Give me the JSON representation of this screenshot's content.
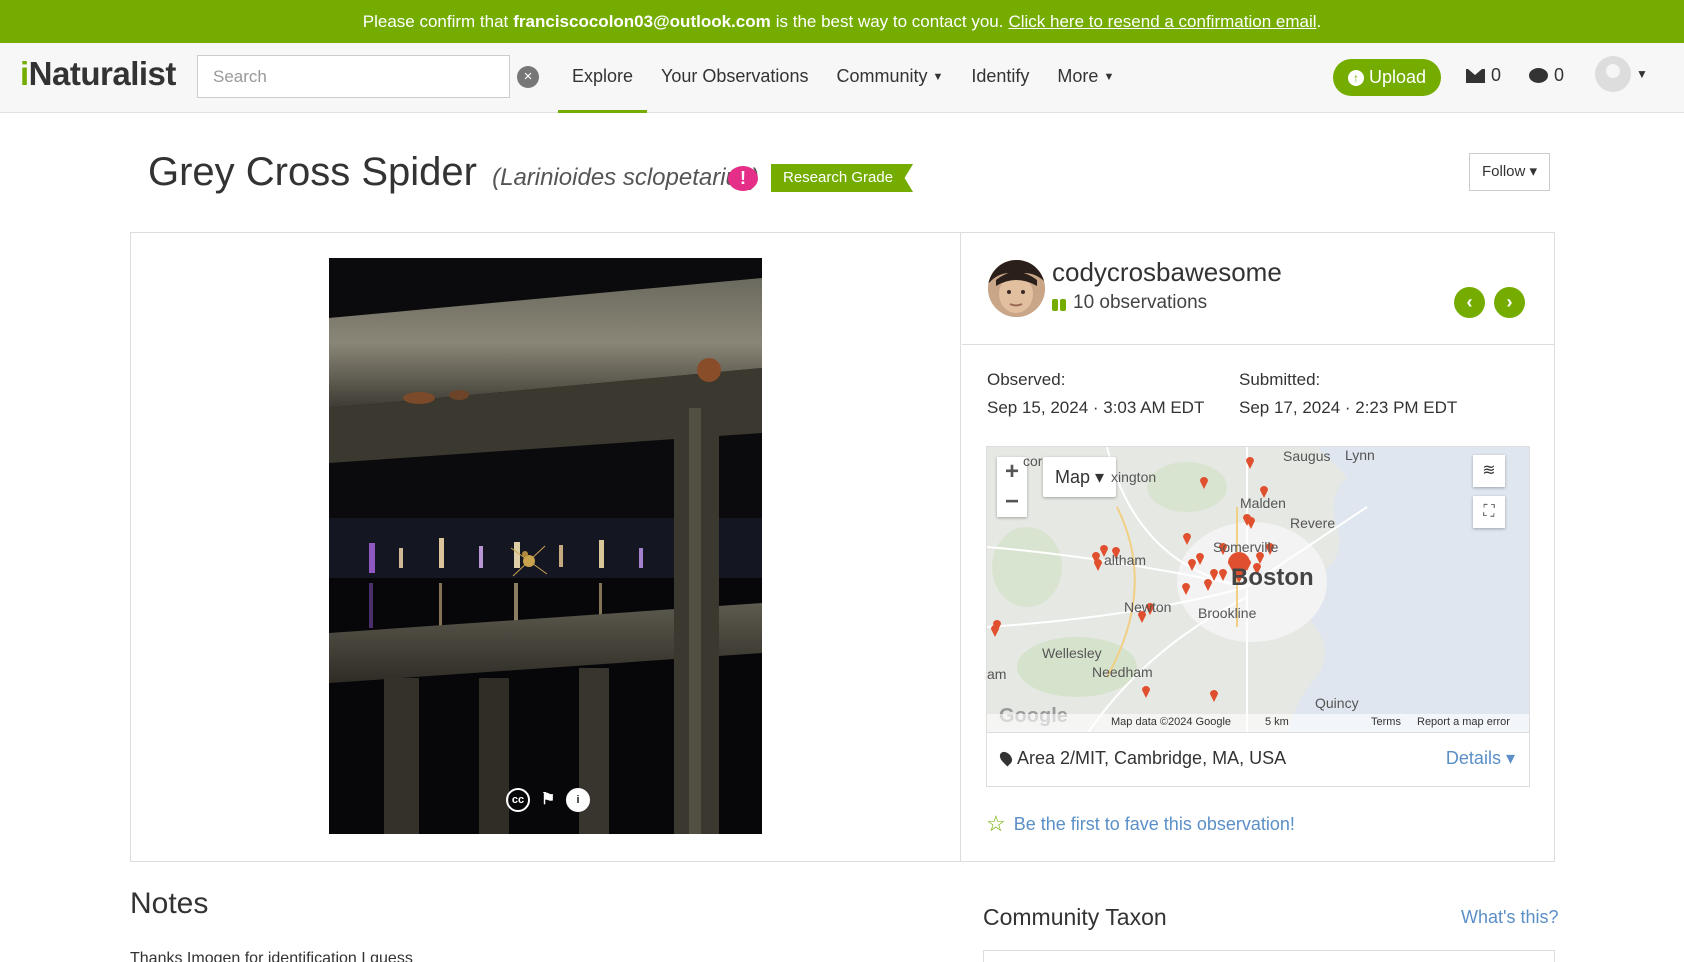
{
  "banner": {
    "prefix": "Please confirm that",
    "email": "franciscocolon03@outlook.com",
    "middle": "is the best way to contact you.",
    "link": "Click here to resend a confirmation email",
    "suffix": "."
  },
  "header": {
    "logo_mark": "i",
    "logo_rest": "Naturalist",
    "search_placeholder": "Search",
    "clear_icon": "×",
    "nav": [
      {
        "label": "Explore"
      },
      {
        "label": "Your Observations"
      },
      {
        "label": "Community"
      },
      {
        "label": "Identify"
      },
      {
        "label": "More"
      }
    ],
    "upload_label": "Upload",
    "messages_count": "0",
    "notifications_count": "0"
  },
  "observation": {
    "common_name": "Grey Cross Spider",
    "scientific_name": "(Larinioides sclopetarius)",
    "alert_icon": "!",
    "quality_grade": "Research Grade",
    "follow_label": "Follow"
  },
  "observer": {
    "username": "codycrosbawesome",
    "observations_label": "10 observations"
  },
  "dates": {
    "observed_label": "Observed:",
    "observed_value": "Sep 15, 2024 · 3:03 AM EDT",
    "submitted_label": "Submitted:",
    "submitted_value": "Sep 17, 2024 · 2:23 PM EDT"
  },
  "map": {
    "type_label": "Map",
    "labels": {
      "saugus": "Saugus",
      "lynn": "Lynn",
      "lexington": "xington",
      "malden": "Malden",
      "revere": "Revere",
      "somerville": "Somerville",
      "waltham": "altham",
      "boston": "Boston",
      "newton": "Newton",
      "brookline": "Brookline",
      "wellesley": "Wellesley",
      "needham": "Needham",
      "quincy": "Quincy",
      "cor": "cor",
      "am": "am"
    },
    "attribution": {
      "google": "Google",
      "data": "Map data ©2024 Google",
      "scale": "5 km",
      "terms": "Terms",
      "report": "Report a map error"
    }
  },
  "location": {
    "text": "Area 2/MIT, Cambridge, MA, USA",
    "details_label": "Details"
  },
  "fave_label": "Be the first to fave this observation!",
  "notes": {
    "heading": "Notes",
    "body": "Thanks Imogen for identification I guess"
  },
  "community_taxon": {
    "heading": "Community Taxon",
    "help_link": "What's this?"
  },
  "colors": {
    "brand": "#74ac00",
    "link": "#5a8fc7",
    "alert": "#e52e88",
    "map_pin": "#e0502e"
  }
}
